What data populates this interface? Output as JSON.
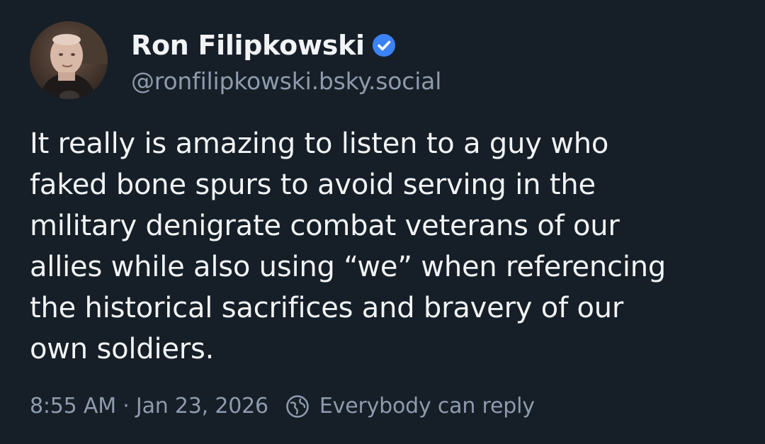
{
  "post": {
    "author": {
      "display_name": "Ron Filipkowski",
      "handle": "@ronfilipkowski.bsky.social",
      "verified": true,
      "avatar_icon": "avatar-photo"
    },
    "text": "It really is amazing to listen to a guy who\nfaked bone spurs to avoid serving in the\nmilitary denigrate combat veterans of our\nallies while also using “we” when referencing\nthe historical sacrifices and bravery of our\nown soldiers.",
    "timestamp": "8:55 AM · Jan 23, 2026",
    "reply_setting": "Everybody can reply",
    "reply_setting_icon": "globe-icon"
  },
  "colors": {
    "background": "#161e27",
    "text": "#f1f3f5",
    "muted": "#8d9bad",
    "verified_blue": "#3b82f6"
  }
}
